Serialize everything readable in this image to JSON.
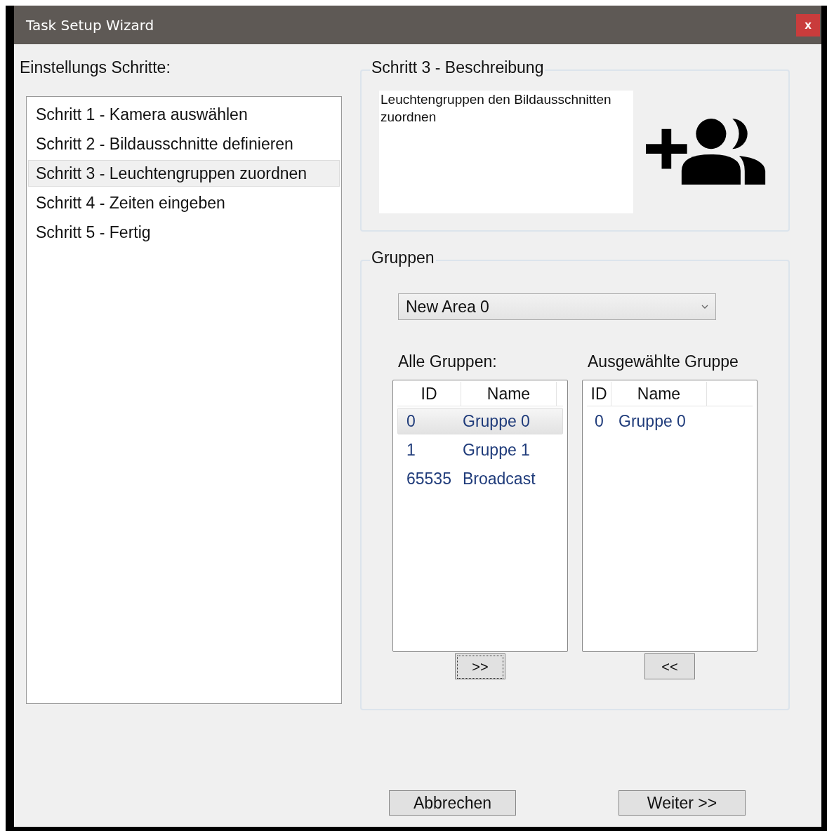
{
  "window": {
    "title": "Task Setup Wizard",
    "close": "x"
  },
  "steps_label": "Einstellungs Schritte:",
  "steps": [
    {
      "label": "Schritt 1 - Kamera auswählen",
      "selected": false
    },
    {
      "label": "Schritt 2 - Bildausschnitte definieren",
      "selected": false
    },
    {
      "label": "Schritt 3 - Leuchtengruppen zuordnen",
      "selected": true
    },
    {
      "label": "Schritt 4 - Zeiten eingeben",
      "selected": false
    },
    {
      "label": "Schritt 5 - Fertig",
      "selected": false
    }
  ],
  "description": {
    "legend": "Schritt 3 - Beschreibung",
    "text": "Leuchtengruppen den Bildausschnitten zuordnen"
  },
  "groups": {
    "legend": "Gruppen",
    "area": "New Area 0",
    "all": {
      "label": "Alle Gruppen:",
      "columns": [
        "ID",
        "Name"
      ],
      "rows": [
        {
          "id": "0",
          "name": "Gruppe 0",
          "selected": true
        },
        {
          "id": "1",
          "name": "Gruppe 1",
          "selected": false
        },
        {
          "id": "65535",
          "name": "Broadcast",
          "selected": false
        }
      ],
      "button": {
        "label": ">>",
        "focused": true
      }
    },
    "chosen": {
      "label": "Ausgewählte Gruppe",
      "columns": [
        "ID",
        "Name"
      ],
      "rows": [
        {
          "id": "0",
          "name": "Gruppe 0",
          "selected": false
        }
      ],
      "button": {
        "label": "<<",
        "focused": false
      }
    }
  },
  "buttons": [
    "Abbrechen",
    "Weiter >>"
  ]
}
